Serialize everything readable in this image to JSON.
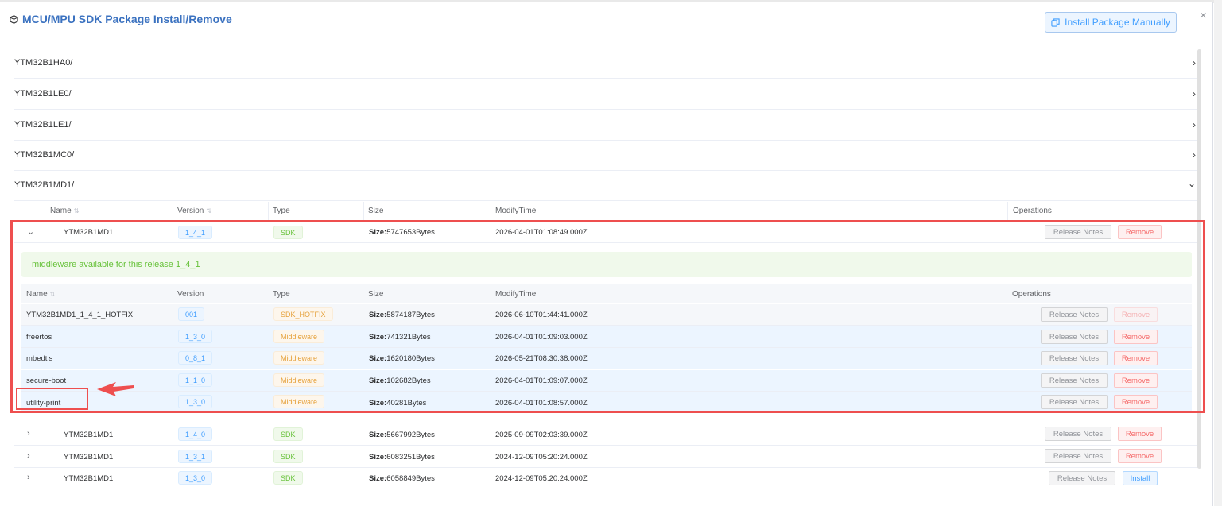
{
  "dialog": {
    "title": "MCU/MPU SDK Package Install/Remove",
    "install_manually_label": "Install Package Manually",
    "close_label": "×"
  },
  "groups": [
    {
      "label": "YTM32B1HA0/",
      "chevron": "›"
    },
    {
      "label": "YTM32B1LE0/",
      "chevron": "›"
    },
    {
      "label": "YTM32B1LE1/",
      "chevron": "›"
    },
    {
      "label": "YTM32B1MC0/",
      "chevron": "›"
    },
    {
      "label": "YTM32B1MD1/",
      "chevron": "⌄"
    }
  ],
  "table": {
    "headers": {
      "name": "Name",
      "version": "Version",
      "type": "Type",
      "size": "Size",
      "modify_time": "ModifyTime",
      "operations": "Operations"
    },
    "size_prefix": "Size:",
    "release_notes_label": "Release Notes",
    "remove_label": "Remove",
    "install_label": "Install",
    "expanded_row": {
      "name": "YTM32B1MD1",
      "version": "1_4_1",
      "type": "SDK",
      "size": "5747653Bytes",
      "modify_time": "2026-04-01T01:08:49.000Z"
    },
    "middleware_banner": "middleware available for this release 1_4_1",
    "middleware": [
      {
        "name": "YTM32B1MD1_1_4_1_HOTFIX",
        "version": "001",
        "type": "SDK_HOTFIX",
        "size": "5874187Bytes",
        "modify_time": "2026-06-10T01:44:41.000Z",
        "remove_disabled": true
      },
      {
        "name": "freertos",
        "version": "1_3_0",
        "type": "Middleware",
        "size": "741321Bytes",
        "modify_time": "2026-04-01T01:09:03.000Z",
        "remove_disabled": false
      },
      {
        "name": "mbedtls",
        "version": "0_8_1",
        "type": "Middleware",
        "size": "1620180Bytes",
        "modify_time": "2026-05-21T08:30:38.000Z",
        "remove_disabled": false
      },
      {
        "name": "secure-boot",
        "version": "1_1_0",
        "type": "Middleware",
        "size": "102682Bytes",
        "modify_time": "2026-04-01T01:09:07.000Z",
        "remove_disabled": false
      },
      {
        "name": "utility-print",
        "version": "1_3_0",
        "type": "Middleware",
        "size": "40281Bytes",
        "modify_time": "2026-04-01T01:08:57.000Z",
        "remove_disabled": false
      }
    ],
    "other_rows": [
      {
        "name": "YTM32B1MD1",
        "version": "1_4_0",
        "type": "SDK",
        "size": "5667992Bytes",
        "modify_time": "2025-09-09T02:03:39.000Z",
        "action": "Remove"
      },
      {
        "name": "YTM32B1MD1",
        "version": "1_3_1",
        "type": "SDK",
        "size": "6083251Bytes",
        "modify_time": "2024-12-09T05:20:24.000Z",
        "action": "Remove"
      },
      {
        "name": "YTM32B1MD1",
        "version": "1_3_0",
        "type": "SDK",
        "size": "6058849Bytes",
        "modify_time": "2024-12-09T05:20:24.000Z",
        "action": "Install"
      }
    ]
  },
  "colors": {
    "accent": "#3b72c0",
    "annotation_red": "#ee4f4f",
    "success": "#67c23a",
    "danger": "#f56c6c",
    "warning": "#e6a23c",
    "primary": "#409eff"
  }
}
